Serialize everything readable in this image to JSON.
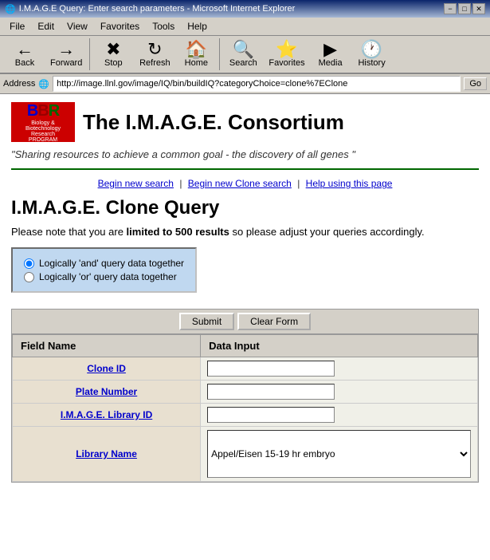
{
  "window": {
    "title": "I.M.A.G.E Query: Enter search parameters - Microsoft Internet Explorer",
    "title_icon": "🌐"
  },
  "titlebar": {
    "minimize_label": "−",
    "maximize_label": "□",
    "close_label": "✕"
  },
  "menu": {
    "items": [
      "File",
      "Edit",
      "View",
      "Favorites",
      "Tools",
      "Help"
    ]
  },
  "toolbar": {
    "back_label": "Back",
    "forward_label": "Forward",
    "stop_label": "Stop",
    "refresh_label": "Refresh",
    "home_label": "Home",
    "search_label": "Search",
    "favorites_label": "Favorites",
    "media_label": "Media",
    "history_label": "History"
  },
  "address": {
    "label": "Address",
    "url": "http://image.llnl.gov/image/IQ/bin/buildIQ?categoryChoice=clone%7EClone",
    "go_label": "Go"
  },
  "header": {
    "bbr_line1": "Biology &",
    "bbr_line2": "Biotechnology",
    "bbr_line3": "Research",
    "bbr_program": "PROGRAM",
    "bbr_letters": "BBR",
    "consortium_title": "The I.M.A.G.E. Consortium"
  },
  "tagline": "\"Sharing resources to achieve a common goal - the discovery of all genes \"",
  "nav": {
    "begin_new_search": "Begin new search",
    "begin_new_clone": "Begin new Clone search",
    "help": "Help using this page",
    "sep1": "|",
    "sep2": "|"
  },
  "page": {
    "title": "I.M.A.G.E. Clone Query",
    "limit_notice_pre": "Please note that you are ",
    "limit_bold": "limited to 500 results",
    "limit_notice_post": " so please adjust your queries accordingly."
  },
  "radio_group": {
    "option1": "Logically 'and' query data together",
    "option2": "Logically 'or' query data together"
  },
  "form": {
    "submit_label": "Submit",
    "clear_label": "Clear Form",
    "col_field": "Field Name",
    "col_input": "Data Input",
    "fields": [
      {
        "label": "Clone ID",
        "type": "input"
      },
      {
        "label": "Plate Number",
        "type": "input"
      },
      {
        "label": "I.M.A.G.E. Library ID",
        "type": "input"
      },
      {
        "label": "Library Name",
        "type": "select",
        "options": [
          "Appel/Eisen 15-19 hr embryo"
        ]
      }
    ]
  }
}
